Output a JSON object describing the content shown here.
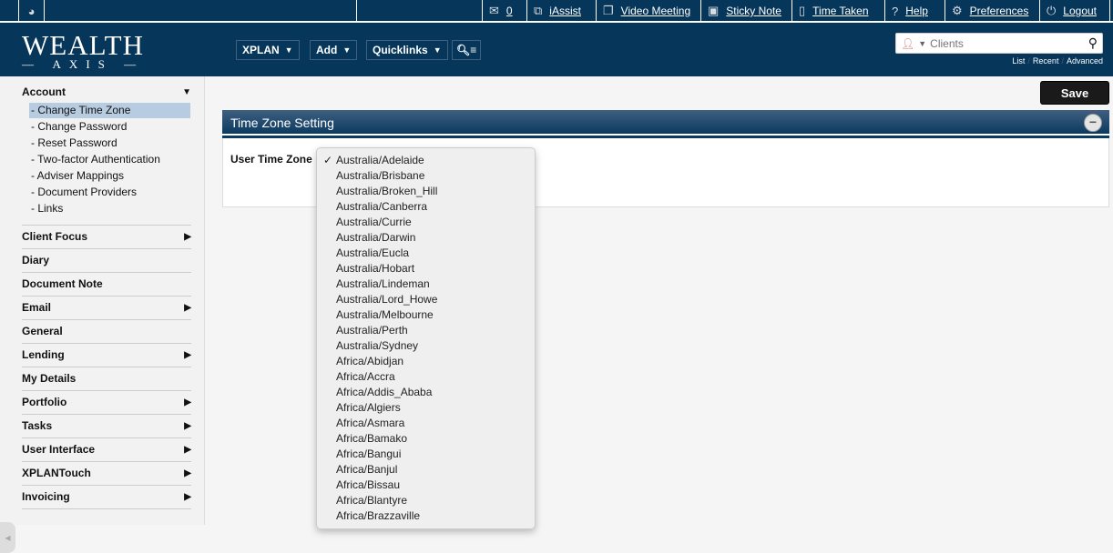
{
  "topbar": {
    "messages_count": "0",
    "links": [
      "iAssist",
      "Video Meeting",
      "Sticky Note",
      "Time Taken",
      "Help",
      "Preferences",
      "Logout"
    ]
  },
  "logo": {
    "line1": "WEALTH",
    "line2": "AXIS"
  },
  "nav": {
    "xplan": "XPLAN",
    "add": "Add",
    "quicklinks": "Quicklinks"
  },
  "search": {
    "placeholder": "Clients",
    "links": [
      "List",
      "Recent",
      "Advanced"
    ]
  },
  "sidebar": {
    "account": {
      "label": "Account",
      "items": [
        "Change Time Zone",
        "Change Password",
        "Reset Password",
        "Two-factor Authentication",
        "Adviser Mappings",
        "Document Providers",
        "Links"
      ],
      "selected": "Change Time Zone"
    },
    "sections": [
      {
        "label": "Client Focus",
        "arrow": true
      },
      {
        "label": "Diary",
        "arrow": false
      },
      {
        "label": "Document Note",
        "arrow": false
      },
      {
        "label": "Email",
        "arrow": true
      },
      {
        "label": "General",
        "arrow": false
      },
      {
        "label": "Lending",
        "arrow": true
      },
      {
        "label": "My Details",
        "arrow": false
      },
      {
        "label": "Portfolio",
        "arrow": true
      },
      {
        "label": "Tasks",
        "arrow": true
      },
      {
        "label": "User Interface",
        "arrow": true
      },
      {
        "label": "XPLANTouch",
        "arrow": true
      },
      {
        "label": "Invoicing",
        "arrow": true
      }
    ]
  },
  "main": {
    "save_label": "Save",
    "panel_title": "Time Zone Setting",
    "field_label": "User Time Zone",
    "timezone_options": [
      "Australia/Adelaide",
      "Australia/Brisbane",
      "Australia/Broken_Hill",
      "Australia/Canberra",
      "Australia/Currie",
      "Australia/Darwin",
      "Australia/Eucla",
      "Australia/Hobart",
      "Australia/Lindeman",
      "Australia/Lord_Howe",
      "Australia/Melbourne",
      "Australia/Perth",
      "Australia/Sydney",
      "Africa/Abidjan",
      "Africa/Accra",
      "Africa/Addis_Ababa",
      "Africa/Algiers",
      "Africa/Asmara",
      "Africa/Bamako",
      "Africa/Bangui",
      "Africa/Banjul",
      "Africa/Bissau",
      "Africa/Blantyre",
      "Africa/Brazzaville"
    ],
    "selected_timezone": "Australia/Adelaide"
  },
  "colors": {
    "header": "#06365a",
    "selected": "#b7cce0"
  }
}
